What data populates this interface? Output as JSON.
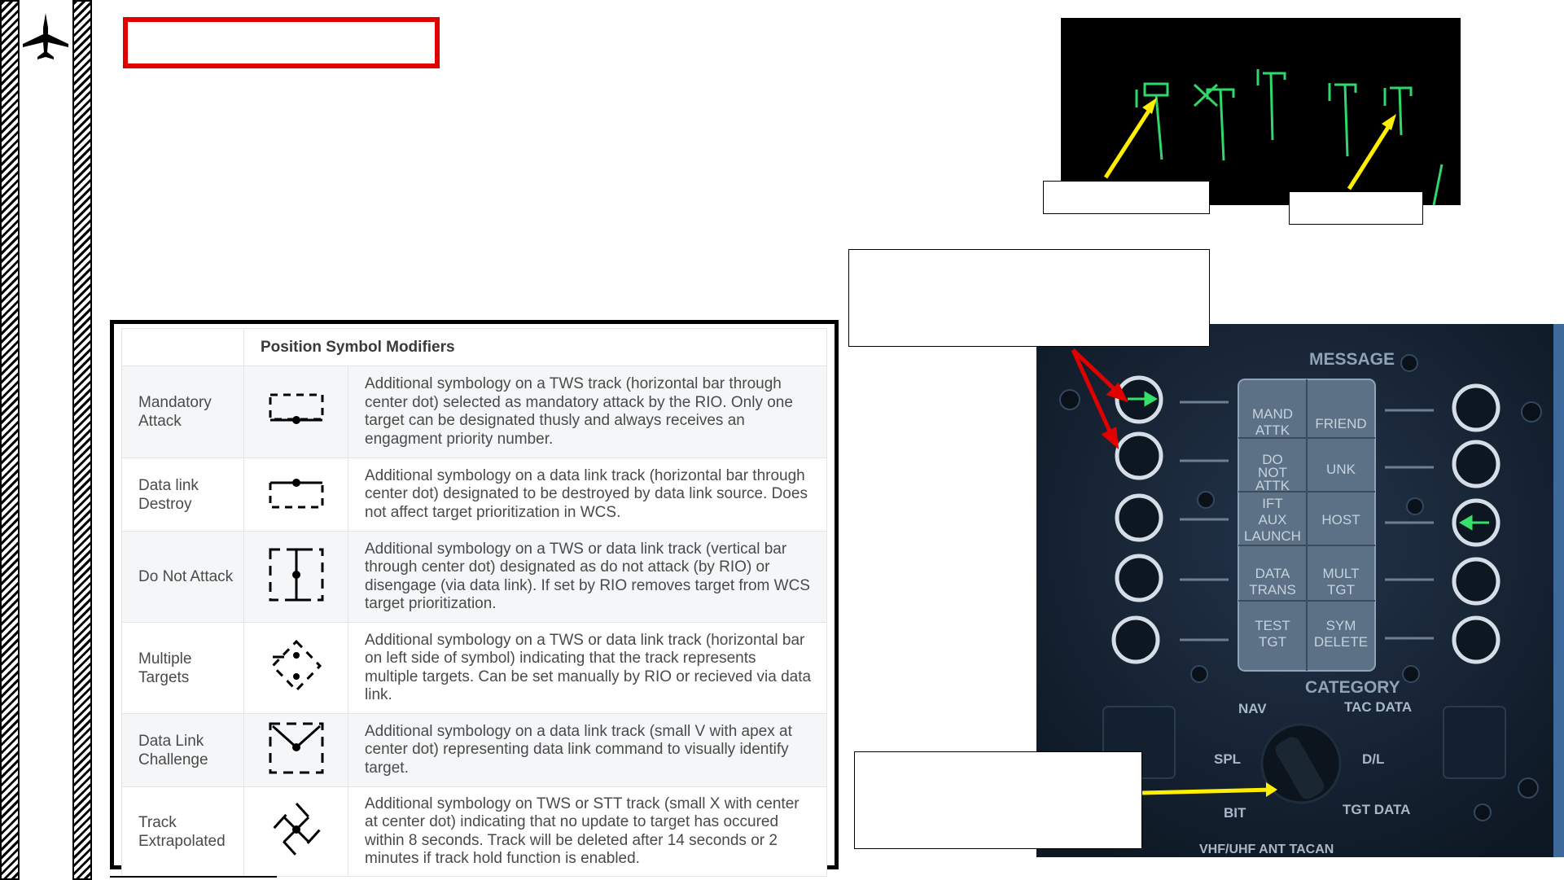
{
  "table": {
    "header": "Position Symbol Modifiers",
    "rows": [
      {
        "name": "Mandatory Attack",
        "symbol": "mandatory-attack-symbol",
        "description": "Additional symbology on a TWS track (horizontal bar through center dot) selected as mandatory attack by the RIO. Only one target can be designated thusly and always receives an engagment priority number."
      },
      {
        "name": "Data link Destroy",
        "symbol": "data-link-destroy-symbol",
        "description": "Additional symbology on a data link track (horizontal bar through center dot) designated to be destroyed by data link source. Does not affect target prioritization in WCS."
      },
      {
        "name": "Do Not Attack",
        "symbol": "do-not-attack-symbol",
        "description": "Additional symbology on a TWS or data link track (vertical bar through center dot) designated as do not attack (by RIO) or disengage (via data link). If set by RIO removes target from WCS target prioritization."
      },
      {
        "name": "Multiple Targets",
        "symbol": "multiple-targets-symbol",
        "description": "Additional symbology on a TWS or data link track (horizontal bar on left side of symbol) indicating that the track represents multiple targets. Can be set manually by RIO or recieved via data link."
      },
      {
        "name": "Data Link Challenge",
        "symbol": "data-link-challenge-symbol",
        "description": "Additional symbology on a data link track (small V with apex at center dot) representing data link command to visually identify target."
      },
      {
        "name": "Track Extrapolated",
        "symbol": "track-extrapolated-symbol",
        "description": "Additional symbology on TWS or STT track (small X with center at center dot) indicating that no update to target has occured within 8 seconds. Track will be deleted after 14 seconds or 2 minutes if track hold function is enabled."
      }
    ]
  },
  "panel": {
    "title": "MESSAGE",
    "category": "CATEGORY",
    "buttons": [
      {
        "line1": "MAND",
        "line2": "ATTK",
        "line3": ""
      },
      {
        "line1": "FRIEND",
        "line2": "",
        "line3": ""
      },
      {
        "line1": "DO",
        "line2": "NOT",
        "line3": "ATTK"
      },
      {
        "line1": "UNK",
        "line2": "",
        "line3": ""
      },
      {
        "line1": "IFT",
        "line2": "AUX",
        "line3": "LAUNCH"
      },
      {
        "line1": "HOST",
        "line2": "",
        "line3": ""
      },
      {
        "line1": "DATA",
        "line2": "TRANS",
        "line3": ""
      },
      {
        "line1": "MULT",
        "line2": "TGT",
        "line3": ""
      },
      {
        "line1": "TEST",
        "line2": "TGT",
        "line3": ""
      },
      {
        "line1": "SYM",
        "line2": "DELETE",
        "line3": ""
      }
    ],
    "knob_labels": {
      "nav": "NAV",
      "tac_data": "TAC DATA",
      "spl": "SPL",
      "dl": "D/L",
      "bit": "BIT",
      "tgt_data": "TGT DATA"
    },
    "bottom_strip": "VHF/UHF ANT     TACAN"
  },
  "colors": {
    "title_box": "#e00000",
    "arrow_red": "#e00000",
    "arrow_yellow": "#ffee00",
    "radar_green": "#2fd86a",
    "panel_bg": "#182433"
  },
  "icons": {
    "logo": "jet-aircraft-icon"
  }
}
